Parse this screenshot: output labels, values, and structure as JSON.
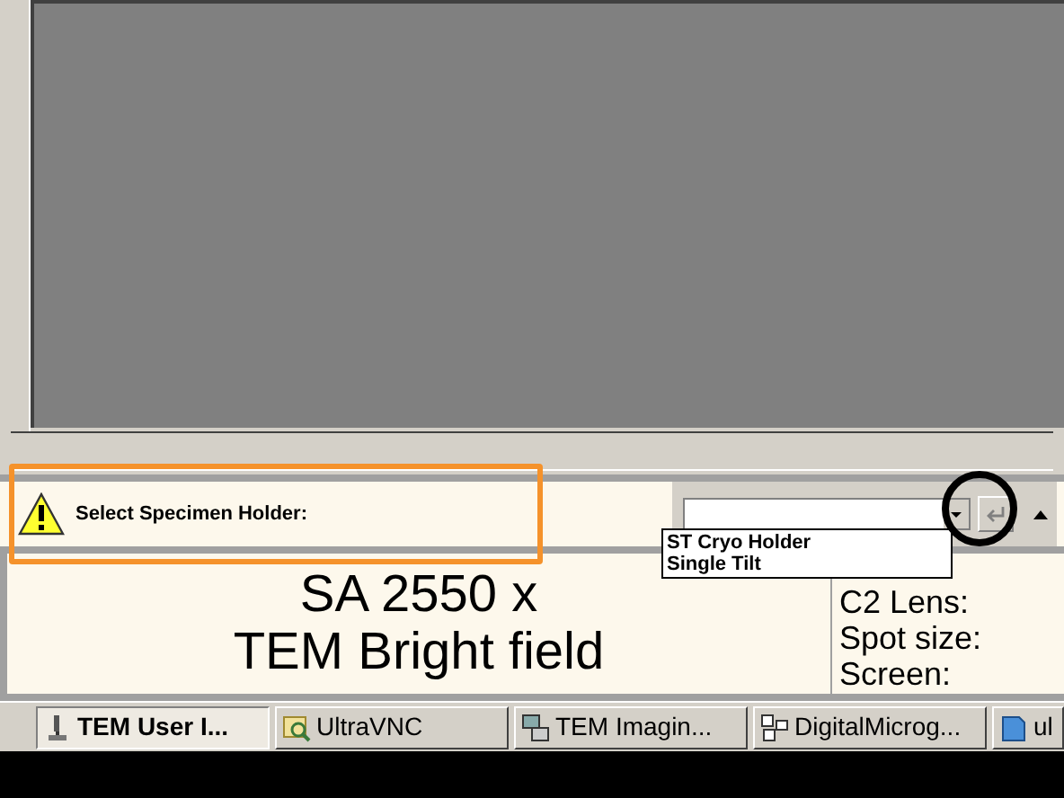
{
  "prompt": {
    "label": "Select Specimen Holder:"
  },
  "holder_dropdown": {
    "options": [
      {
        "label": "ST Cryo Holder",
        "selected": false
      },
      {
        "label": "Single Tilt",
        "selected": false
      }
    ]
  },
  "status": {
    "lines": [
      "SA 2550 x",
      "TEM Bright field"
    ]
  },
  "parameters": [
    "C2 Lens:",
    "Spot size:",
    "Screen:"
  ],
  "taskbar": [
    {
      "label": "TEM User I...",
      "selected": true,
      "kind": "microscope"
    },
    {
      "label": "UltraVNC",
      "selected": false,
      "kind": "vnc"
    },
    {
      "label": "TEM Imagin...",
      "selected": false,
      "kind": "imaging"
    },
    {
      "label": "DigitalMicrog...",
      "selected": false,
      "kind": "digital"
    },
    {
      "label": "ul",
      "selected": false,
      "kind": "document"
    }
  ]
}
